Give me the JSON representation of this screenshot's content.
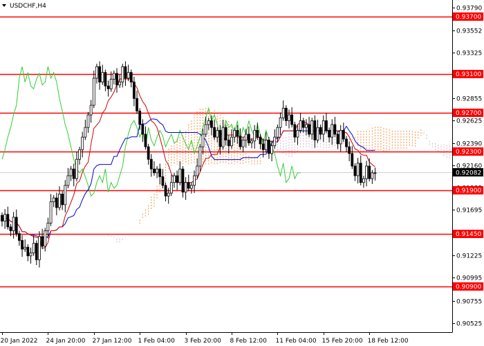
{
  "chart_data": {
    "type": "candlestick",
    "title": "USDCHF,H4",
    "ylim": [
      0.9043,
      0.9387
    ],
    "grid": false,
    "y_ticks": [
      0.9379,
      0.93552,
      0.93325,
      0.93095,
      0.92855,
      0.92625,
      0.9239,
      0.9216,
      0.91925,
      0.91695,
      0.91465,
      0.91225,
      0.90995,
      0.90755,
      0.90525
    ],
    "y_tick_labels": [
      "0.93790",
      "0.93552",
      "0.93325",
      "0.93095",
      "0.92855",
      "0.92625",
      "0.92390",
      "0.92160",
      "0.91925",
      "0.91695",
      "0.91465",
      "0.91225",
      "0.90995",
      "0.90755",
      "0.90525"
    ],
    "x_labels": [
      "20 Jan 2022",
      "24 Jan 20:00",
      "27 Jan 12:00",
      "1 Feb 04:00",
      "3 Feb 20:00",
      "8 Feb 12:00",
      "11 Feb 04:00",
      "15 Feb 20:00",
      "18 Feb 12:00"
    ],
    "x_label_bars": [
      0,
      16,
      32,
      48,
      64,
      80,
      96,
      112,
      128
    ],
    "levels": [
      0.937,
      0.931,
      0.927,
      0.923,
      0.919,
      0.9145,
      0.909
    ],
    "level_labels": [
      "0.93700",
      "0.93100",
      "0.92700",
      "0.92300",
      "0.91900",
      "0.91450",
      "0.90900"
    ],
    "last_price": 0.92082,
    "last_price_label": "0.92082",
    "close_series": [
      0.9158,
      0.9165,
      0.9152,
      0.9148,
      0.9162,
      0.9145,
      0.9138,
      0.9129,
      0.9131,
      0.9122,
      0.9125,
      0.9135,
      0.9118,
      0.9142,
      0.9132,
      0.9148,
      0.9156,
      0.9178,
      0.9182,
      0.9172,
      0.9186,
      0.9175,
      0.9195,
      0.9205,
      0.9212,
      0.9202,
      0.9222,
      0.9232,
      0.9245,
      0.9255,
      0.9268,
      0.9278,
      0.9306,
      0.9318,
      0.9302,
      0.9312,
      0.9298,
      0.9295,
      0.9305,
      0.9311,
      0.9299,
      0.9302,
      0.9318,
      0.9306,
      0.9312,
      0.9302,
      0.9285,
      0.9272,
      0.9258,
      0.9248,
      0.9235,
      0.9222,
      0.9212,
      0.9208,
      0.9212,
      0.9204,
      0.9195,
      0.9184,
      0.9187,
      0.9198,
      0.9205,
      0.9198,
      0.9212,
      0.9188,
      0.9198,
      0.9192,
      0.9195,
      0.9205,
      0.9215,
      0.9235,
      0.9248,
      0.9258,
      0.9262,
      0.9255,
      0.9245,
      0.9252,
      0.9235,
      0.9255,
      0.9242,
      0.9236,
      0.9245,
      0.9252,
      0.9246,
      0.9235,
      0.9242,
      0.9248,
      0.9239,
      0.9241,
      0.9252,
      0.9245,
      0.9238,
      0.9232,
      0.9242,
      0.9228,
      0.9236,
      0.9245,
      0.9255,
      0.9265,
      0.9275,
      0.9262,
      0.9268,
      0.9258,
      0.9245,
      0.9252,
      0.9262,
      0.9255,
      0.9258,
      0.9248,
      0.9262,
      0.9242,
      0.9255,
      0.9248,
      0.9262,
      0.9252,
      0.9245,
      0.9258,
      0.9248,
      0.9238,
      0.9252,
      0.9243,
      0.9235,
      0.9228,
      0.9215,
      0.9205,
      0.9218,
      0.9198,
      0.9202,
      0.9215,
      0.9202,
      0.9208,
      0.9208
    ]
  }
}
